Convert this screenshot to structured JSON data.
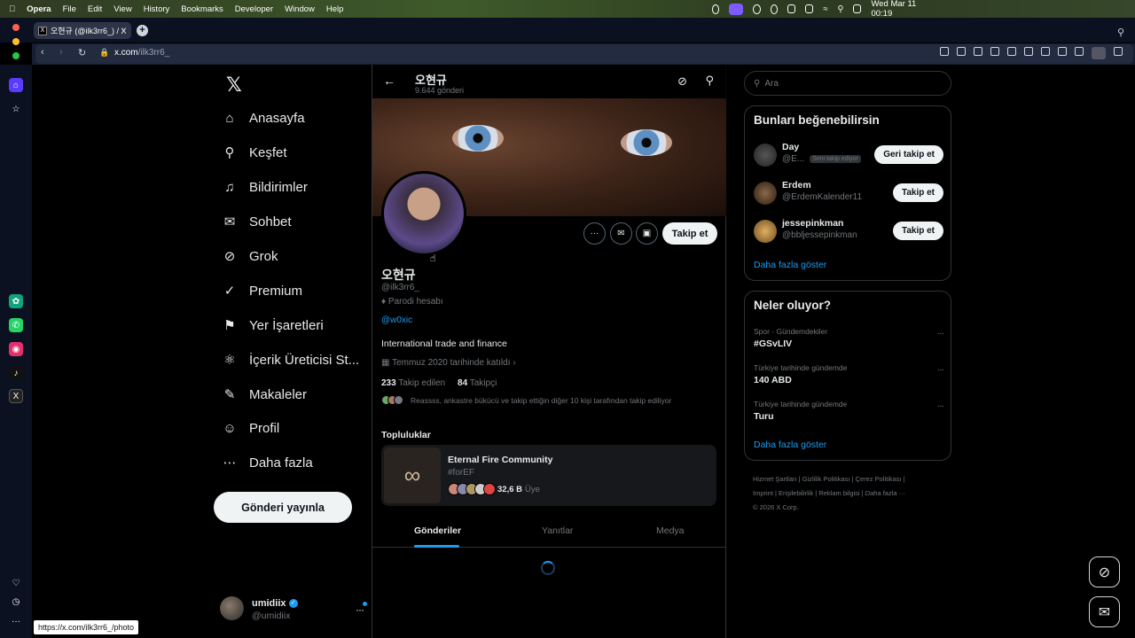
{
  "menubar": {
    "apple": "",
    "items": [
      "Opera",
      "File",
      "Edit",
      "View",
      "History",
      "Bookmarks",
      "Developer",
      "Window",
      "Help"
    ],
    "clock": "Wed Mar 11  00:19"
  },
  "browser": {
    "tab_title": "오현규 (@ilk3rr6_) / X",
    "url_domain": "x.com",
    "url_path": "/ilk3rr6_",
    "status_url": "https://x.com/ilk3rr6_/photo"
  },
  "leftnav": {
    "items": [
      "Anasayfa",
      "Keşfet",
      "Bildirimler",
      "Sohbet",
      "Grok",
      "Premium",
      "Yer İşaretleri",
      "İçerik Üreticisi St...",
      "Makaleler",
      "Profil",
      "Daha fazla"
    ],
    "post_button": "Gönderi yayınla",
    "account_name": "umidiix",
    "account_handle": "@umidiix"
  },
  "profile": {
    "header_name": "오현규",
    "header_posts": "9.644 gönderi",
    "name": "오현규",
    "handle": "@ilk3rr6_",
    "parody": "Parodi hesabı",
    "link": "@w0xic",
    "bio": "International trade and finance",
    "joined": "Temmuz 2020 tarihinde katıldı",
    "following_count": "233",
    "following_label": "Takip edilen",
    "followers_count": "84",
    "followers_label": "Takipçi",
    "followed_by": "Reassss, ankastre bükücü ve takip ettiğin diğer 10 kişi tarafından takip ediliyor",
    "follow_button": "Takip et",
    "communities_title": "Topluluklar",
    "community_name": "Eternal Fire Community",
    "community_tag": "#forEF",
    "community_members_count": "32,6 B",
    "community_members_label": "Üye",
    "tabs": [
      "Gönderiler",
      "Yanıtlar",
      "Medya"
    ]
  },
  "right": {
    "search_placeholder": "Ara",
    "suggest_title": "Bunları beğenebilirsin",
    "suggestions": [
      {
        "name": "Day",
        "handle": "@E...",
        "tag": "Seni takip ediyor",
        "button": "Geri takip et"
      },
      {
        "name": "Erdem",
        "handle": "@ErdemKalender11",
        "tag": "",
        "button": "Takip et"
      },
      {
        "name": "jessepinkman",
        "handle": "@bbljessepinkman",
        "tag": "",
        "button": "Takip et"
      }
    ],
    "show_more": "Daha fazla göster",
    "trends_title": "Neler oluyor?",
    "trends": [
      {
        "context": "Spor · Gündemdekiler",
        "topic": "#GSvLIV"
      },
      {
        "context": "Türkiye tarihinde gündemde",
        "topic": "140 ABD"
      },
      {
        "context": "Türkiye tarihinde gündemde",
        "topic": "Turu"
      }
    ],
    "trends_more": "Daha fazla göster",
    "footer_line1": "Hizmet Şartları  |  Gizlilik Politikası  |  Çerez Politikası  |",
    "footer_line2": "Imprint  |  Erişilebilirlik  |  Reklam bilgisi  |  Daha fazla ···",
    "footer_line3": "© 2026 X Corp."
  },
  "colors": {
    "accent": "#1d9bf0",
    "bg": "#000000",
    "border": "#2f3336",
    "muted": "#71767b"
  }
}
